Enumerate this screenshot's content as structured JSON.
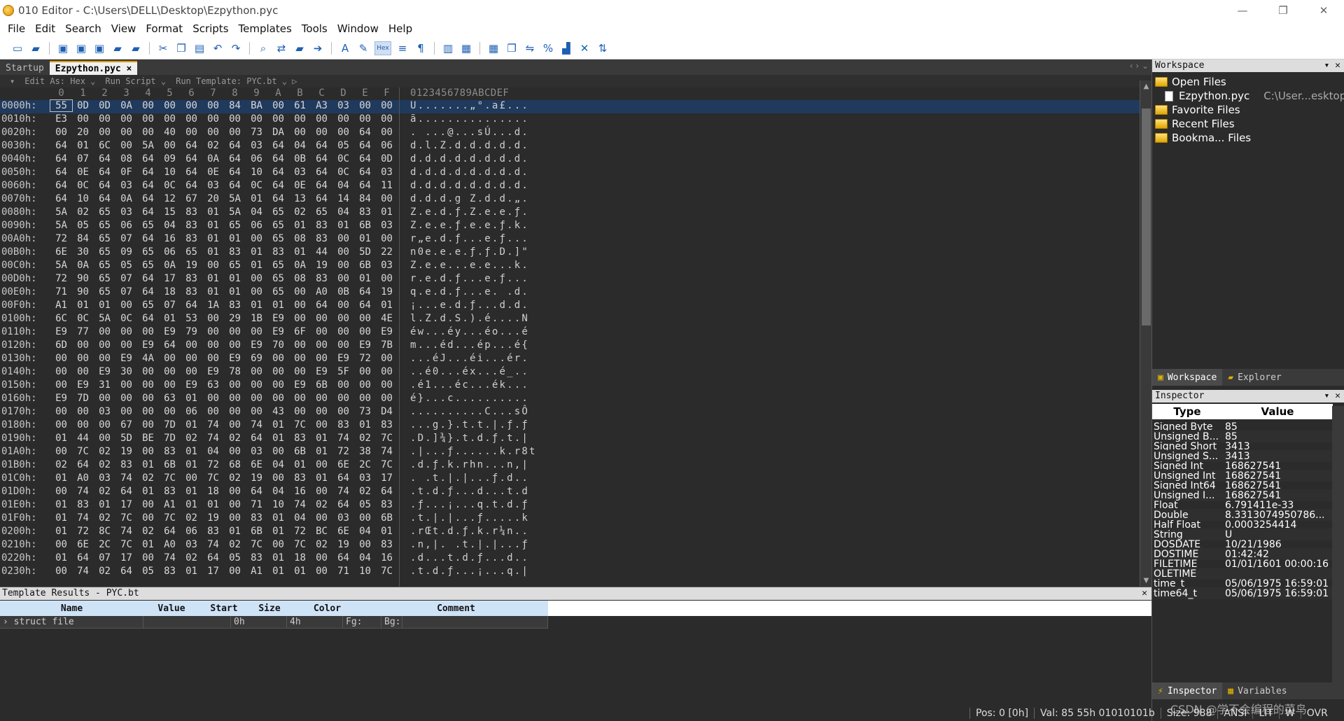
{
  "window": {
    "title": "010 Editor - C:\\Users\\DELL\\Desktop\\Ezpython.pyc"
  },
  "menu": [
    "File",
    "Edit",
    "Search",
    "View",
    "Format",
    "Scripts",
    "Templates",
    "Tools",
    "Window",
    "Help"
  ],
  "tabs": [
    {
      "label": "Startup",
      "active": false
    },
    {
      "label": "Ezpython.pyc ×",
      "active": true
    }
  ],
  "hexbar": {
    "edit_as": "Edit As: Hex ⌄",
    "run_script": "Run Script ⌄",
    "run_template": "Run Template: PYC.bt ⌄ ▷"
  },
  "hex": {
    "columns": [
      "0",
      "1",
      "2",
      "3",
      "4",
      "5",
      "6",
      "7",
      "8",
      "9",
      "A",
      "B",
      "C",
      "D",
      "E",
      "F"
    ],
    "ascii_header": "0123456789ABCDEF",
    "rows": [
      {
        "addr": "0000h:",
        "bytes": [
          "55",
          "0D",
          "0D",
          "0A",
          "00",
          "00",
          "00",
          "00",
          "84",
          "BA",
          "00",
          "61",
          "A3",
          "03",
          "00",
          "00"
        ],
        "ascii": "U.......„°.a£..."
      },
      {
        "addr": "0010h:",
        "bytes": [
          "E3",
          "00",
          "00",
          "00",
          "00",
          "00",
          "00",
          "00",
          "00",
          "00",
          "00",
          "00",
          "00",
          "00",
          "00",
          "00"
        ],
        "ascii": "ã..............."
      },
      {
        "addr": "0020h:",
        "bytes": [
          "00",
          "20",
          "00",
          "00",
          "00",
          "40",
          "00",
          "00",
          "00",
          "73",
          "DA",
          "00",
          "00",
          "00",
          "64",
          "00"
        ],
        "ascii": ". ...@...sÚ...d."
      },
      {
        "addr": "0030h:",
        "bytes": [
          "64",
          "01",
          "6C",
          "00",
          "5A",
          "00",
          "64",
          "02",
          "64",
          "03",
          "64",
          "04",
          "64",
          "05",
          "64",
          "06"
        ],
        "ascii": "d.l.Z.d.d.d.d.d."
      },
      {
        "addr": "0040h:",
        "bytes": [
          "64",
          "07",
          "64",
          "08",
          "64",
          "09",
          "64",
          "0A",
          "64",
          "06",
          "64",
          "0B",
          "64",
          "0C",
          "64",
          "0D"
        ],
        "ascii": "d.d.d.d.d.d.d.d."
      },
      {
        "addr": "0050h:",
        "bytes": [
          "64",
          "0E",
          "64",
          "0F",
          "64",
          "10",
          "64",
          "0E",
          "64",
          "10",
          "64",
          "03",
          "64",
          "0C",
          "64",
          "03"
        ],
        "ascii": "d.d.d.d.d.d.d.d."
      },
      {
        "addr": "0060h:",
        "bytes": [
          "64",
          "0C",
          "64",
          "03",
          "64",
          "0C",
          "64",
          "03",
          "64",
          "0C",
          "64",
          "0E",
          "64",
          "04",
          "64",
          "11"
        ],
        "ascii": "d.d.d.d.d.d.d.d."
      },
      {
        "addr": "0070h:",
        "bytes": [
          "64",
          "10",
          "64",
          "0A",
          "64",
          "12",
          "67",
          "20",
          "5A",
          "01",
          "64",
          "13",
          "64",
          "14",
          "84",
          "00"
        ],
        "ascii": "d.d.d.g Z.d.d.„."
      },
      {
        "addr": "0080h:",
        "bytes": [
          "5A",
          "02",
          "65",
          "03",
          "64",
          "15",
          "83",
          "01",
          "5A",
          "04",
          "65",
          "02",
          "65",
          "04",
          "83",
          "01"
        ],
        "ascii": "Z.e.d.ƒ.Z.e.e.ƒ."
      },
      {
        "addr": "0090h:",
        "bytes": [
          "5A",
          "05",
          "65",
          "06",
          "65",
          "04",
          "83",
          "01",
          "65",
          "06",
          "65",
          "01",
          "83",
          "01",
          "6B",
          "03"
        ],
        "ascii": "Z.e.e.ƒ.e.e.ƒ.k."
      },
      {
        "addr": "00A0h:",
        "bytes": [
          "72",
          "84",
          "65",
          "07",
          "64",
          "16",
          "83",
          "01",
          "01",
          "00",
          "65",
          "08",
          "83",
          "00",
          "01",
          "00"
        ],
        "ascii": "r„e.d.ƒ...e.ƒ..."
      },
      {
        "addr": "00B0h:",
        "bytes": [
          "6E",
          "30",
          "65",
          "09",
          "65",
          "06",
          "65",
          "01",
          "83",
          "01",
          "83",
          "01",
          "44",
          "00",
          "5D",
          "22"
        ],
        "ascii": "n0e.e.e.ƒ.ƒ.D.]\""
      },
      {
        "addr": "00C0h:",
        "bytes": [
          "5A",
          "0A",
          "65",
          "05",
          "65",
          "0A",
          "19",
          "00",
          "65",
          "01",
          "65",
          "0A",
          "19",
          "00",
          "6B",
          "03"
        ],
        "ascii": "Z.e.e...e.e...k."
      },
      {
        "addr": "00D0h:",
        "bytes": [
          "72",
          "90",
          "65",
          "07",
          "64",
          "17",
          "83",
          "01",
          "01",
          "00",
          "65",
          "08",
          "83",
          "00",
          "01",
          "00"
        ],
        "ascii": "r.e.d.ƒ...e.ƒ..."
      },
      {
        "addr": "00E0h:",
        "bytes": [
          "71",
          "90",
          "65",
          "07",
          "64",
          "18",
          "83",
          "01",
          "01",
          "00",
          "65",
          "00",
          "A0",
          "0B",
          "64",
          "19"
        ],
        "ascii": "q.e.d.ƒ...e. .d."
      },
      {
        "addr": "00F0h:",
        "bytes": [
          "A1",
          "01",
          "01",
          "00",
          "65",
          "07",
          "64",
          "1A",
          "83",
          "01",
          "01",
          "00",
          "64",
          "00",
          "64",
          "01"
        ],
        "ascii": "¡...e.d.ƒ...d.d."
      },
      {
        "addr": "0100h:",
        "bytes": [
          "6C",
          "0C",
          "5A",
          "0C",
          "64",
          "01",
          "53",
          "00",
          "29",
          "1B",
          "E9",
          "00",
          "00",
          "00",
          "00",
          "4E"
        ],
        "ascii": "l.Z.d.S.).é....N"
      },
      {
        "addr": "0110h:",
        "bytes": [
          "E9",
          "77",
          "00",
          "00",
          "00",
          "E9",
          "79",
          "00",
          "00",
          "00",
          "E9",
          "6F",
          "00",
          "00",
          "00",
          "E9"
        ],
        "ascii": "éw...éy...éo...é"
      },
      {
        "addr": "0120h:",
        "bytes": [
          "6D",
          "00",
          "00",
          "00",
          "E9",
          "64",
          "00",
          "00",
          "00",
          "E9",
          "70",
          "00",
          "00",
          "00",
          "E9",
          "7B"
        ],
        "ascii": "m...éd...ép...é{"
      },
      {
        "addr": "0130h:",
        "bytes": [
          "00",
          "00",
          "00",
          "E9",
          "4A",
          "00",
          "00",
          "00",
          "E9",
          "69",
          "00",
          "00",
          "00",
          "E9",
          "72",
          "00"
        ],
        "ascii": "...éJ...éi...ér."
      },
      {
        "addr": "0140h:",
        "bytes": [
          "00",
          "00",
          "E9",
          "30",
          "00",
          "00",
          "00",
          "E9",
          "78",
          "00",
          "00",
          "00",
          "E9",
          "5F",
          "00",
          "00"
        ],
        "ascii": "..é0...éx...é_.."
      },
      {
        "addr": "0150h:",
        "bytes": [
          "00",
          "E9",
          "31",
          "00",
          "00",
          "00",
          "E9",
          "63",
          "00",
          "00",
          "00",
          "E9",
          "6B",
          "00",
          "00",
          "00"
        ],
        "ascii": ".é1...éc...ék..."
      },
      {
        "addr": "0160h:",
        "bytes": [
          "E9",
          "7D",
          "00",
          "00",
          "00",
          "63",
          "01",
          "00",
          "00",
          "00",
          "00",
          "00",
          "00",
          "00",
          "00",
          "00"
        ],
        "ascii": "é}...c.........."
      },
      {
        "addr": "0170h:",
        "bytes": [
          "00",
          "00",
          "03",
          "00",
          "00",
          "00",
          "06",
          "00",
          "00",
          "00",
          "43",
          "00",
          "00",
          "00",
          "73",
          "D4"
        ],
        "ascii": "..........C...sÔ"
      },
      {
        "addr": "0180h:",
        "bytes": [
          "00",
          "00",
          "00",
          "67",
          "00",
          "7D",
          "01",
          "74",
          "00",
          "74",
          "01",
          "7C",
          "00",
          "83",
          "01",
          "83"
        ],
        "ascii": "...g.}.t.t.|.ƒ.ƒ"
      },
      {
        "addr": "0190h:",
        "bytes": [
          "01",
          "44",
          "00",
          "5D",
          "BE",
          "7D",
          "02",
          "74",
          "02",
          "64",
          "01",
          "83",
          "01",
          "74",
          "02",
          "7C"
        ],
        "ascii": ".D.]¾}.t.d.ƒ.t.|"
      },
      {
        "addr": "01A0h:",
        "bytes": [
          "00",
          "7C",
          "02",
          "19",
          "00",
          "83",
          "01",
          "04",
          "00",
          "03",
          "00",
          "6B",
          "01",
          "72",
          "38",
          "74"
        ],
        "ascii": ".|...ƒ......k.r8t"
      },
      {
        "addr": "01B0h:",
        "bytes": [
          "02",
          "64",
          "02",
          "83",
          "01",
          "6B",
          "01",
          "72",
          "68",
          "6E",
          "04",
          "01",
          "00",
          "6E",
          "2C",
          "7C"
        ],
        "ascii": ".d.ƒ.k.rhn...n,|"
      },
      {
        "addr": "01C0h:",
        "bytes": [
          "01",
          "A0",
          "03",
          "74",
          "02",
          "7C",
          "00",
          "7C",
          "02",
          "19",
          "00",
          "83",
          "01",
          "64",
          "03",
          "17"
        ],
        "ascii": ". .t.|.|...ƒ.d.."
      },
      {
        "addr": "01D0h:",
        "bytes": [
          "00",
          "74",
          "02",
          "64",
          "01",
          "83",
          "01",
          "18",
          "00",
          "64",
          "04",
          "16",
          "00",
          "74",
          "02",
          "64"
        ],
        "ascii": ".t.d.ƒ...d...t.d"
      },
      {
        "addr": "01E0h:",
        "bytes": [
          "01",
          "83",
          "01",
          "17",
          "00",
          "A1",
          "01",
          "01",
          "00",
          "71",
          "10",
          "74",
          "02",
          "64",
          "05",
          "83"
        ],
        "ascii": ".ƒ...¡...q.t.d.ƒ"
      },
      {
        "addr": "01F0h:",
        "bytes": [
          "01",
          "74",
          "02",
          "7C",
          "00",
          "7C",
          "02",
          "19",
          "00",
          "83",
          "01",
          "04",
          "00",
          "03",
          "00",
          "6B"
        ],
        "ascii": ".t.|.|...ƒ.....k"
      },
      {
        "addr": "0200h:",
        "bytes": [
          "01",
          "72",
          "8C",
          "74",
          "02",
          "64",
          "06",
          "83",
          "01",
          "6B",
          "01",
          "72",
          "BC",
          "6E",
          "04",
          "01"
        ],
        "ascii": ".rŒt.d.ƒ.k.r¼n.."
      },
      {
        "addr": "0210h:",
        "bytes": [
          "00",
          "6E",
          "2C",
          "7C",
          "01",
          "A0",
          "03",
          "74",
          "02",
          "7C",
          "00",
          "7C",
          "02",
          "19",
          "00",
          "83"
        ],
        "ascii": ".n,|. .t.|.|...ƒ"
      },
      {
        "addr": "0220h:",
        "bytes": [
          "01",
          "64",
          "07",
          "17",
          "00",
          "74",
          "02",
          "64",
          "05",
          "83",
          "01",
          "18",
          "00",
          "64",
          "04",
          "16"
        ],
        "ascii": ".d...t.d.ƒ...d.."
      },
      {
        "addr": "0230h:",
        "bytes": [
          "00",
          "74",
          "02",
          "64",
          "05",
          "83",
          "01",
          "17",
          "00",
          "A1",
          "01",
          "01",
          "00",
          "71",
          "10",
          "7C"
        ],
        "ascii": ".t.d.ƒ...¡...q.|"
      }
    ]
  },
  "template_results": {
    "title": "Template Results - PYC.bt",
    "headers": [
      "Name",
      "Value",
      "Start",
      "Size",
      "Color",
      "Comment"
    ],
    "row": {
      "name": "› struct file",
      "value": "",
      "start": "0h",
      "size": "4h",
      "fg": "Fg:",
      "bg": "Bg:",
      "comment": ""
    }
  },
  "workspace": {
    "title": "Workspace",
    "items": [
      {
        "label": "Open Files",
        "type": "folder"
      },
      {
        "label": "Ezpython.pyc",
        "type": "file",
        "path": "C:\\User...esktop\\"
      },
      {
        "label": "Favorite Files",
        "type": "folder"
      },
      {
        "label": "Recent Files",
        "type": "folder"
      },
      {
        "label": "Bookma... Files",
        "type": "folder"
      }
    ],
    "tabs": [
      "Workspace",
      "Explorer"
    ]
  },
  "inspector": {
    "title": "Inspector",
    "headers": [
      "Type",
      "Value"
    ],
    "rows": [
      {
        "type": "Signed Byte",
        "value": "85"
      },
      {
        "type": "Unsigned B...",
        "value": "85"
      },
      {
        "type": "Signed Short",
        "value": "3413"
      },
      {
        "type": "Unsigned S...",
        "value": "3413"
      },
      {
        "type": "Signed Int",
        "value": "168627541"
      },
      {
        "type": "Unsigned Int",
        "value": "168627541"
      },
      {
        "type": "Signed Int64",
        "value": "168627541"
      },
      {
        "type": "Unsigned I...",
        "value": "168627541"
      },
      {
        "type": "Float",
        "value": "6.791411e-33"
      },
      {
        "type": "Double",
        "value": "8.3313074950786..."
      },
      {
        "type": "Half Float",
        "value": "0.0003254414"
      },
      {
        "type": "String",
        "value": "U"
      },
      {
        "type": "DOSDATE",
        "value": "10/21/1986"
      },
      {
        "type": "DOSTIME",
        "value": "01:42:42"
      },
      {
        "type": "FILETIME",
        "value": "01/01/1601 00:00:16"
      },
      {
        "type": "OLETIME",
        "value": ""
      },
      {
        "type": "time_t",
        "value": "05/06/1975 16:59:01"
      },
      {
        "type": "time64_t",
        "value": "05/06/1975 16:59:01"
      }
    ],
    "tabs": [
      "Inspector",
      "Variables"
    ]
  },
  "status": {
    "pos": "Pos: 0 [0h]",
    "val": "Val: 85 55h 01010101b",
    "size": "Size: 988",
    "enc": "ANSI",
    "endian": "LIT",
    "mode1": "W",
    "mode2": "OVR"
  },
  "watermark": "CSDN @学不会编程的菜鸟"
}
